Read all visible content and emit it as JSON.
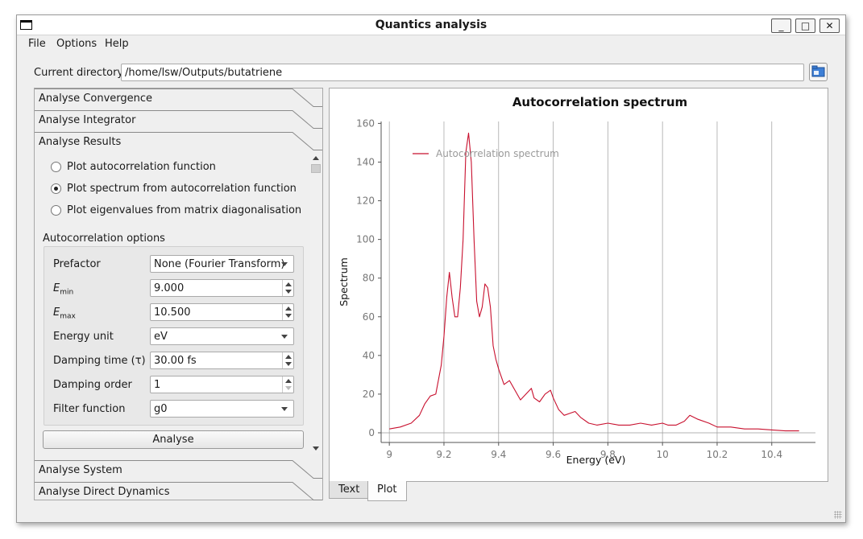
{
  "window": {
    "title": "Quantics analysis",
    "controls": [
      "_",
      "□",
      "✕"
    ]
  },
  "menu": [
    "File",
    "Options",
    "Help"
  ],
  "directory": {
    "label": "Current directory",
    "value": "/home/lsw/Outputs/butatriene",
    "browse_icon": "folder-icon"
  },
  "left_panel": {
    "sections_top": [
      "Analyse Convergence",
      "Analyse Integrator",
      "Analyse Results"
    ],
    "sections_bottom": [
      "Analyse System",
      "Analyse Direct Dynamics"
    ],
    "results": {
      "radios": [
        {
          "label": "Plot autocorrelation function",
          "checked": false
        },
        {
          "label": "Plot spectrum from autocorrelation function",
          "checked": true
        },
        {
          "label": "Plot eigenvalues from matrix diagonalisation",
          "checked": false
        }
      ],
      "options_title": "Autocorrelation options",
      "fields": [
        {
          "label": "Prefactor",
          "type": "combo",
          "value": "None (Fourier Transform)"
        },
        {
          "label": "E",
          "sub": "min",
          "type": "spin",
          "value": "9.000"
        },
        {
          "label": "E",
          "sub": "max",
          "type": "spin",
          "value": "10.500"
        },
        {
          "label": "Energy unit",
          "type": "combo",
          "value": "eV"
        },
        {
          "label": "Damping time (τ)",
          "type": "spin",
          "value": "30.00 fs"
        },
        {
          "label": "Damping order",
          "type": "spin",
          "value": "1",
          "down_disabled": true
        },
        {
          "label": "Filter function",
          "type": "combo",
          "value": "g0"
        }
      ],
      "analyse_button": "Analyse"
    }
  },
  "tabs": [
    {
      "label": "Text",
      "active": false
    },
    {
      "label": "Plot",
      "active": true
    }
  ],
  "colors": {
    "series": "#c8102e",
    "grid": "#8c8c8c"
  },
  "chart_data": {
    "type": "line",
    "title": "Autocorrelation spectrum",
    "xlabel": "Energy (eV)",
    "ylabel": "Spectrum",
    "xlim": [
      8.97,
      10.56
    ],
    "ylim": [
      -5,
      161
    ],
    "xticks": [
      9,
      9.2,
      9.4,
      9.6,
      9.8,
      10,
      10.2,
      10.4
    ],
    "xtick_labels": [
      "9",
      "9.2",
      "9.4",
      "9.6",
      "9.8",
      "10",
      "10.2",
      "10.4"
    ],
    "yticks": [
      0,
      20,
      40,
      60,
      80,
      100,
      120,
      140,
      160
    ],
    "grid": "vertical",
    "legend": {
      "position": "top-left",
      "entries": [
        "Autocorrelation spectrum"
      ]
    },
    "series": [
      {
        "name": "Autocorrelation spectrum",
        "x": [
          9.0,
          9.04,
          9.08,
          9.11,
          9.13,
          9.15,
          9.17,
          9.19,
          9.2,
          9.21,
          9.22,
          9.23,
          9.24,
          9.25,
          9.26,
          9.27,
          9.28,
          9.29,
          9.3,
          9.31,
          9.32,
          9.33,
          9.34,
          9.35,
          9.36,
          9.37,
          9.38,
          9.39,
          9.4,
          9.42,
          9.44,
          9.46,
          9.48,
          9.5,
          9.52,
          9.53,
          9.55,
          9.57,
          9.59,
          9.6,
          9.62,
          9.64,
          9.66,
          9.68,
          9.7,
          9.73,
          9.76,
          9.8,
          9.84,
          9.88,
          9.92,
          9.96,
          10.0,
          10.02,
          10.05,
          10.08,
          10.1,
          10.13,
          10.17,
          10.2,
          10.25,
          10.3,
          10.35,
          10.4,
          10.45,
          10.5
        ],
        "y": [
          2,
          3,
          5,
          9,
          15,
          19,
          20,
          35,
          50,
          70,
          83,
          70,
          60,
          60,
          75,
          100,
          145,
          155,
          140,
          100,
          68,
          60,
          65,
          77,
          75,
          65,
          45,
          38,
          33,
          25,
          27,
          22,
          17,
          20,
          23,
          18,
          16,
          20,
          22,
          18,
          12,
          9,
          10,
          11,
          8,
          5,
          4,
          5,
          4,
          4,
          5,
          4,
          5,
          4,
          4,
          6,
          9,
          7,
          5,
          3,
          3,
          2,
          2,
          1.5,
          1,
          1
        ]
      }
    ]
  }
}
